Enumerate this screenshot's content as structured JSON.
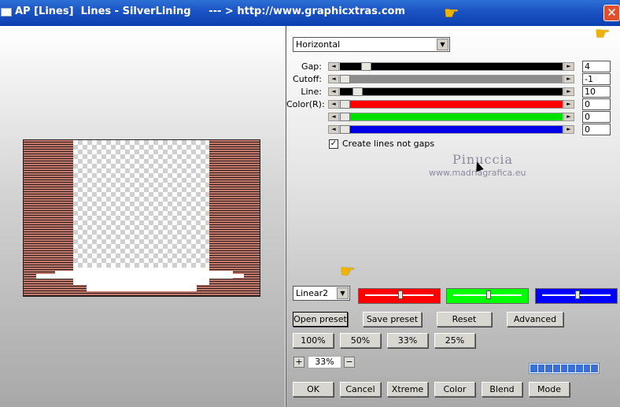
{
  "window": {
    "title": "AP [Lines]  Lines - SilverLining     --- > http://www.graphicxtras.com",
    "close_glyph": "✕"
  },
  "direction": {
    "selected": "Horizontal"
  },
  "sliders": [
    {
      "label": "Gap:",
      "value": "4",
      "fill_color": "#000000",
      "position": 0.1
    },
    {
      "label": "Cutoff:",
      "value": "-1",
      "fill_color": "#8c8c8c",
      "position": 0.0
    },
    {
      "label": "Line:",
      "value": "10",
      "fill_color": "#000000",
      "position": 0.06
    },
    {
      "label": "Color(R):",
      "value": "0",
      "fill_color": "#ff0000",
      "position": 0.0
    },
    {
      "label": "",
      "value": "0",
      "fill_color": "#00e000",
      "position": 0.0
    },
    {
      "label": "",
      "value": "0",
      "fill_color": "#0000e8",
      "position": 0.0
    }
  ],
  "create_lines_checkbox": {
    "label": "Create lines not gaps",
    "checked": true,
    "glyph": "✓"
  },
  "watermark": {
    "line1": "Pinuccia",
    "line2": "www.madriagrafica.eu"
  },
  "blend_mode": {
    "selected": "Linear2"
  },
  "color_swatches": [
    {
      "color": "#ff0000",
      "knob": 0.5
    },
    {
      "color": "#00ff00",
      "knob": 0.5
    },
    {
      "color": "#0000ff",
      "knob": 0.5
    }
  ],
  "preset_buttons": {
    "open": "Open preset",
    "save": "Save preset",
    "reset": "Reset",
    "advanced": "Advanced"
  },
  "zoom_buttons": [
    "100%",
    "50%",
    "33%",
    "25%"
  ],
  "zoom": {
    "minus": "−",
    "plus": "+",
    "value": "33%"
  },
  "bottom_buttons": {
    "ok": "OK",
    "cancel": "Cancel",
    "xtreme": "Xtreme",
    "color": "Color",
    "blend": "Blend",
    "mode": "Mode"
  },
  "arrows": {
    "left": "◄",
    "right": "►",
    "down": "▼"
  },
  "icons": {
    "hand": "hand-pointer-icon"
  },
  "progress": {
    "segments": 9
  }
}
